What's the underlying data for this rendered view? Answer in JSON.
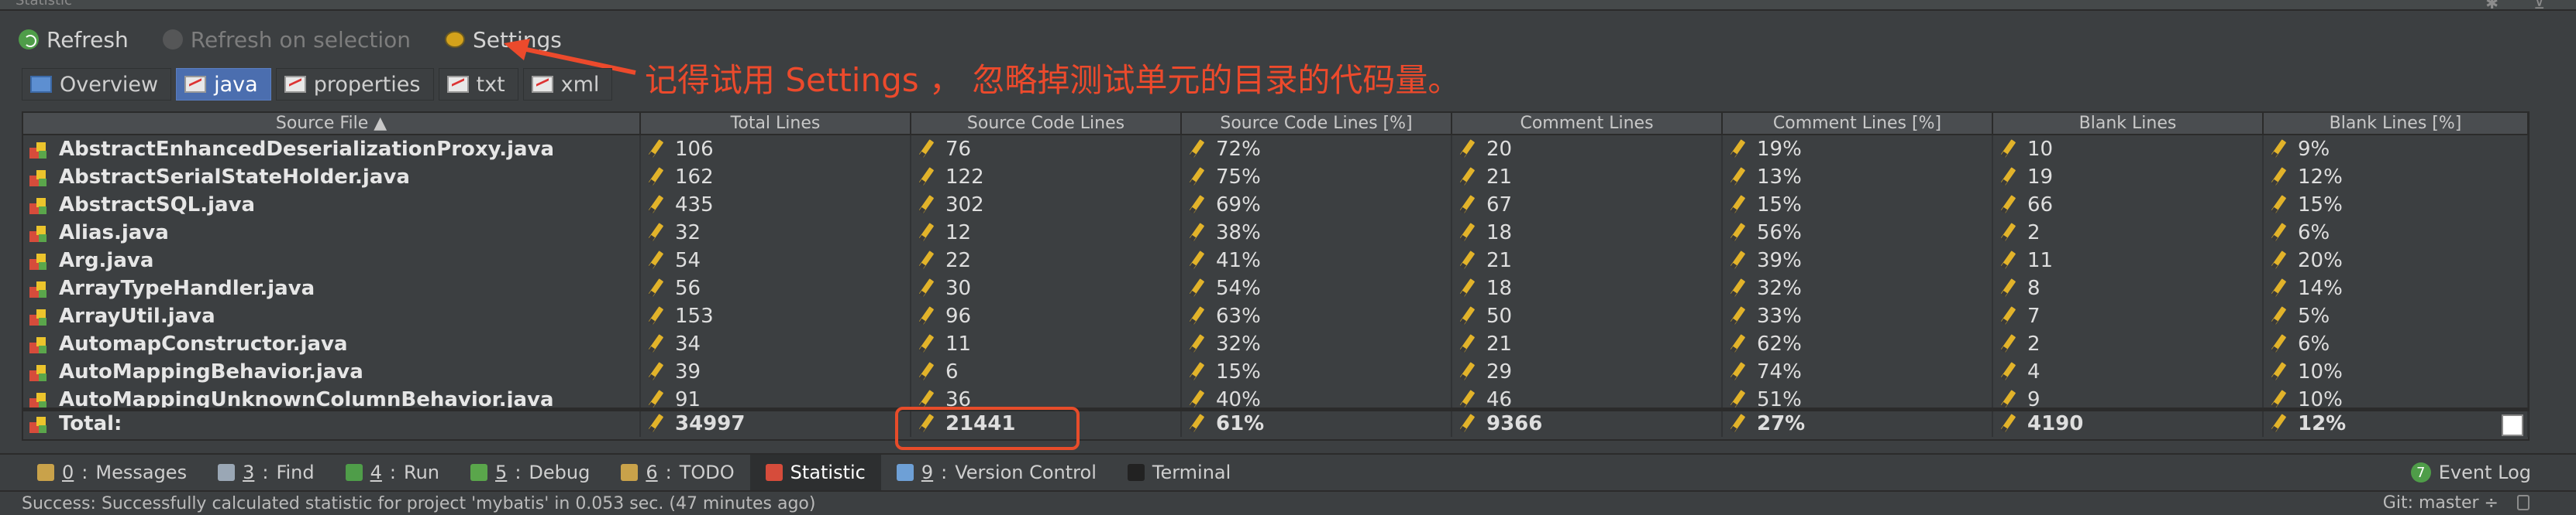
{
  "window": {
    "title": "Statistic"
  },
  "toolbar": {
    "refresh_label": "Refresh",
    "refresh_selection_label": "Refresh on selection",
    "settings_label": "Settings"
  },
  "annotation": {
    "text": "记得试用 Settings ， 忽略掉测试单元的目录的代码量。",
    "color": "#ec4a2c"
  },
  "tabs": [
    {
      "label": "Overview",
      "selected": false
    },
    {
      "label": "java",
      "selected": true
    },
    {
      "label": "properties",
      "selected": false
    },
    {
      "label": "txt",
      "selected": false
    },
    {
      "label": "xml",
      "selected": false
    }
  ],
  "table": {
    "columns": [
      "Source File ▲",
      "Total Lines",
      "Source Code Lines",
      "Source Code Lines [%]",
      "Comment Lines",
      "Comment Lines [%]",
      "Blank Lines",
      "Blank Lines [%]"
    ],
    "rows": [
      [
        "AbstractEnhancedDeserializationProxy.java",
        "106",
        "76",
        "72%",
        "20",
        "19%",
        "10",
        "9%"
      ],
      [
        "AbstractSerialStateHolder.java",
        "162",
        "122",
        "75%",
        "21",
        "13%",
        "19",
        "12%"
      ],
      [
        "AbstractSQL.java",
        "435",
        "302",
        "69%",
        "67",
        "15%",
        "66",
        "15%"
      ],
      [
        "Alias.java",
        "32",
        "12",
        "38%",
        "18",
        "56%",
        "2",
        "6%"
      ],
      [
        "Arg.java",
        "54",
        "22",
        "41%",
        "21",
        "39%",
        "11",
        "20%"
      ],
      [
        "ArrayTypeHandler.java",
        "56",
        "30",
        "54%",
        "18",
        "32%",
        "8",
        "14%"
      ],
      [
        "ArrayUtil.java",
        "153",
        "96",
        "63%",
        "50",
        "33%",
        "7",
        "5%"
      ],
      [
        "AutomapConstructor.java",
        "34",
        "11",
        "32%",
        "21",
        "62%",
        "2",
        "6%"
      ],
      [
        "AutoMappingBehavior.java",
        "39",
        "6",
        "15%",
        "29",
        "74%",
        "4",
        "10%"
      ],
      [
        "AutoMappingUnknownColumnBehavior.java",
        "91",
        "36",
        "40%",
        "46",
        "51%",
        "9",
        "10%"
      ]
    ],
    "total": [
      "Total:",
      "34997",
      "21441",
      "61%",
      "9366",
      "27%",
      "4190",
      "12%"
    ]
  },
  "toolwindows": [
    {
      "key": "0",
      "label": "Messages",
      "icon": "messages-icon",
      "color": "#c9a24a"
    },
    {
      "key": "3",
      "label": "Find",
      "icon": "find-icon",
      "color": "#9aa7b5"
    },
    {
      "key": "4",
      "label": "Run",
      "icon": "run-icon",
      "color": "#4f9d49"
    },
    {
      "key": "5",
      "label": "Debug",
      "icon": "debug-icon",
      "color": "#5aa64b"
    },
    {
      "key": "6",
      "label": "TODO",
      "icon": "todo-icon",
      "color": "#c9a24a"
    },
    {
      "key": "",
      "label": "Statistic",
      "icon": "statistic-icon",
      "color": "#d64c3b"
    },
    {
      "key": "9",
      "label": "Version Control",
      "icon": "vcs-icon",
      "color": "#6ea0d6"
    },
    {
      "key": "",
      "label": "Terminal",
      "icon": "terminal-icon",
      "color": "#222222"
    }
  ],
  "eventlog": {
    "count": "7",
    "label": "Event Log"
  },
  "status": {
    "message": "Success: Successfully calculated statistic for project 'mybatis' in 0.053 sec. (47 minutes ago)",
    "git": "Git: master ÷"
  }
}
